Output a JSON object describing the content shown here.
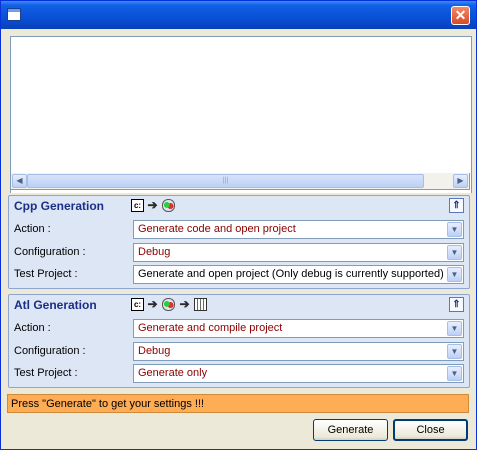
{
  "window": {
    "close_glyph": "✕"
  },
  "scrollbar": {
    "left_glyph": "◀",
    "right_glyph": "▶",
    "thumb_grip": "|||"
  },
  "cpp": {
    "title": "Cpp Generation",
    "collapse_glyph": "⇑",
    "icons": [
      "c-source-icon",
      "arrow-icon",
      "compile-icon"
    ],
    "rows": [
      {
        "label": "Action :",
        "value": "Generate code and open project",
        "color": "#8b0000"
      },
      {
        "label": "Configuration :",
        "value": "Debug",
        "color": "#8b0000"
      },
      {
        "label": "Test Project :",
        "value": "Generate and open project (Only debug is currently supported)",
        "color": "#000000"
      }
    ]
  },
  "atl": {
    "title": "Atl Generation",
    "collapse_glyph": "⇑",
    "icons": [
      "c-source-icon",
      "arrow-icon",
      "compile-icon",
      "arrow-icon",
      "binary-icon"
    ],
    "rows": [
      {
        "label": "Action :",
        "value": "Generate and compile project",
        "color": "#8b0000"
      },
      {
        "label": "Configuration :",
        "value": "Debug",
        "color": "#8b0000"
      },
      {
        "label": "Test Project :",
        "value": "Generate only",
        "color": "#8b0000"
      }
    ]
  },
  "status": {
    "message": "Press \"Generate\" to get your settings !!!",
    "color": "#ffad55"
  },
  "buttons": {
    "generate": "Generate",
    "close": "Close"
  },
  "combo_glyph": "▼",
  "icon_glyphs": {
    "c": "c:",
    "arrow": "➔"
  }
}
